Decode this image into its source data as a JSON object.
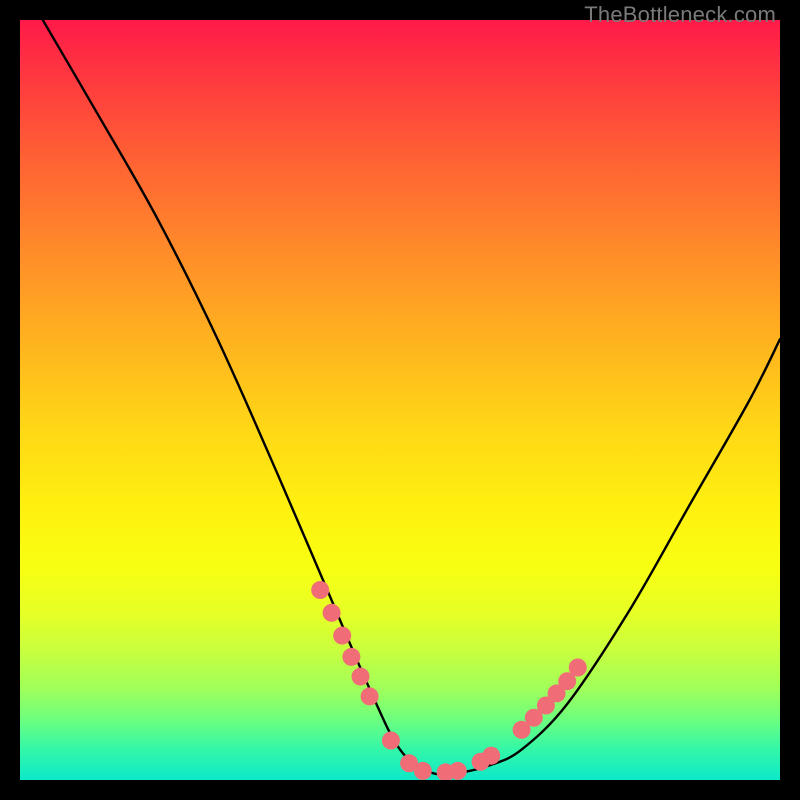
{
  "watermark": "TheBottleneck.com",
  "chart_data": {
    "type": "line",
    "title": "",
    "xlabel": "",
    "ylabel": "",
    "xlim": [
      0,
      100
    ],
    "ylim": [
      0,
      100
    ],
    "grid": false,
    "legend": false,
    "series": [
      {
        "name": "bottleneck-curve",
        "x": [
          3,
          10,
          18,
          26,
          34,
          40,
          46,
          50,
          54,
          58,
          62,
          66,
          72,
          80,
          88,
          96,
          100
        ],
        "y": [
          100,
          88,
          74,
          58,
          40,
          26,
          12,
          4,
          1,
          1,
          2,
          4,
          10,
          22,
          36,
          50,
          58
        ]
      }
    ],
    "highlight_points": {
      "name": "pink-dots",
      "color": "#f06d78",
      "x": [
        39.5,
        41.0,
        42.4,
        43.6,
        44.8,
        46.0,
        48.8,
        51.2,
        53.0,
        56.0,
        57.6,
        60.6,
        62.0,
        66.0,
        67.6,
        69.2,
        70.6,
        72.0,
        73.4
      ],
      "y": [
        25.0,
        22.0,
        19.0,
        16.2,
        13.6,
        11.0,
        5.2,
        2.2,
        1.2,
        1.0,
        1.2,
        2.4,
        3.2,
        6.6,
        8.2,
        9.8,
        11.4,
        13.0,
        14.8
      ]
    },
    "gradient_stops": [
      {
        "pos": 0,
        "color": "#ff1a49"
      },
      {
        "pos": 8,
        "color": "#ff3a3f"
      },
      {
        "pos": 18,
        "color": "#ff6034"
      },
      {
        "pos": 30,
        "color": "#ff8a2a"
      },
      {
        "pos": 42,
        "color": "#ffb21f"
      },
      {
        "pos": 54,
        "color": "#ffd816"
      },
      {
        "pos": 64,
        "color": "#fff00f"
      },
      {
        "pos": 72,
        "color": "#f8ff12"
      },
      {
        "pos": 78,
        "color": "#e6ff26"
      },
      {
        "pos": 83,
        "color": "#c8ff3e"
      },
      {
        "pos": 88,
        "color": "#a0ff5a"
      },
      {
        "pos": 92,
        "color": "#6dff7e"
      },
      {
        "pos": 96,
        "color": "#33f7a8"
      },
      {
        "pos": 100,
        "color": "#0de8c9"
      }
    ]
  }
}
